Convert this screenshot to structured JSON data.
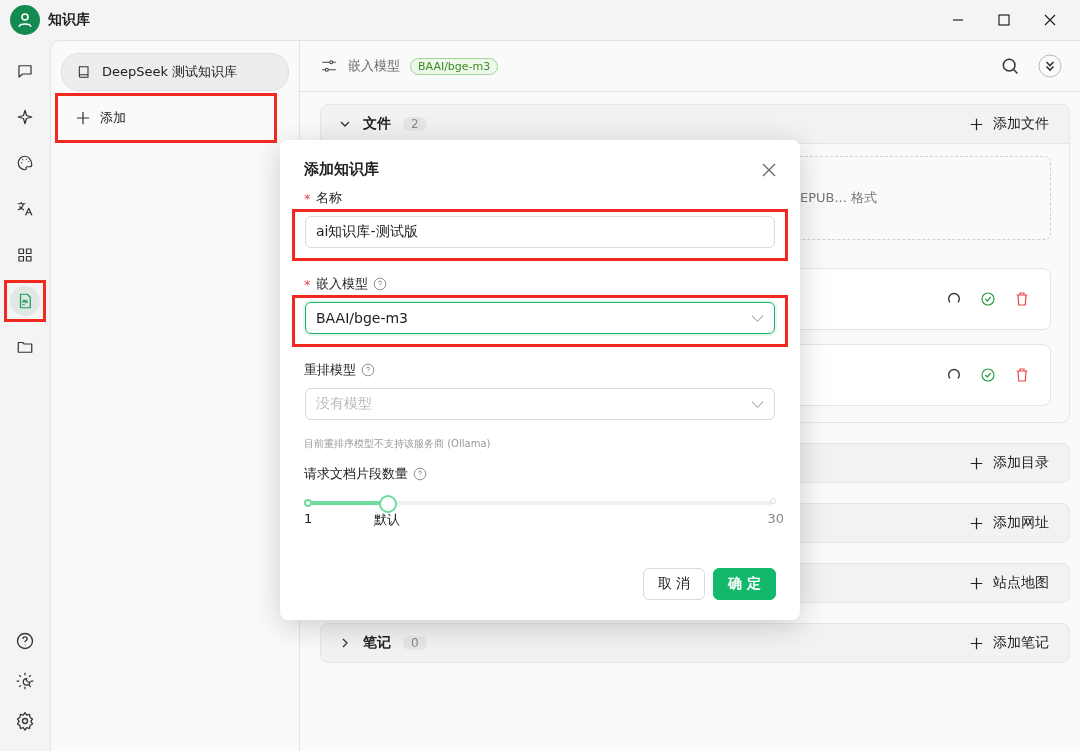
{
  "window": {
    "title": "知识库"
  },
  "nav_rail": {
    "items": [
      {
        "selected": false
      },
      {
        "selected": false
      },
      {
        "selected": false
      },
      {
        "selected": false
      },
      {
        "selected": false
      },
      {
        "selected": true,
        "highlighted": true
      },
      {
        "selected": false
      }
    ]
  },
  "knowledge_list": {
    "items": [
      {
        "label": "DeepSeek 测试知识库",
        "selected": true
      }
    ],
    "add_button": {
      "label": "添加",
      "highlighted": true
    }
  },
  "header": {
    "label": "嵌入模型",
    "badge": "BAAI/bge-m3"
  },
  "sections": [
    {
      "title": "文件",
      "count": "2",
      "expanded": true,
      "action": "添加文件",
      "dropzone_text": "EPUB... 格式",
      "files": [
        {
          "done": true
        },
        {
          "done": true
        }
      ]
    },
    {
      "action": "添加目录",
      "expanded": false
    },
    {
      "action": "添加网址",
      "expanded": false
    },
    {
      "action": "站点地图",
      "expanded": false
    },
    {
      "title": "笔记",
      "count": "0",
      "expanded": false,
      "action": "添加笔记"
    }
  ],
  "dialog": {
    "title": "添加知识库",
    "fields": [
      {
        "kind": "input",
        "label": "名称",
        "required_mark": "*",
        "value": "ai知识库-测试版",
        "focused": false,
        "highlighted": true
      },
      {
        "kind": "select",
        "label": "嵌入模型",
        "required_mark": "*",
        "help": true,
        "value": "BAAI/bge-m3",
        "focused": true,
        "highlighted": true
      },
      {
        "kind": "select",
        "label": "重排模型",
        "help": true,
        "placeholder": "没有模型",
        "focused": false,
        "note": "目前重排序模型不支持该服务商 (Ollama)"
      },
      {
        "kind": "slider",
        "label": "请求文档片段数量",
        "help": true,
        "level": 0.17,
        "marks": [
          "1",
          "默认",
          "30"
        ]
      }
    ],
    "buttons": [
      {
        "label": "取 消",
        "primary": false
      },
      {
        "label": "确 定",
        "primary": true
      }
    ]
  }
}
